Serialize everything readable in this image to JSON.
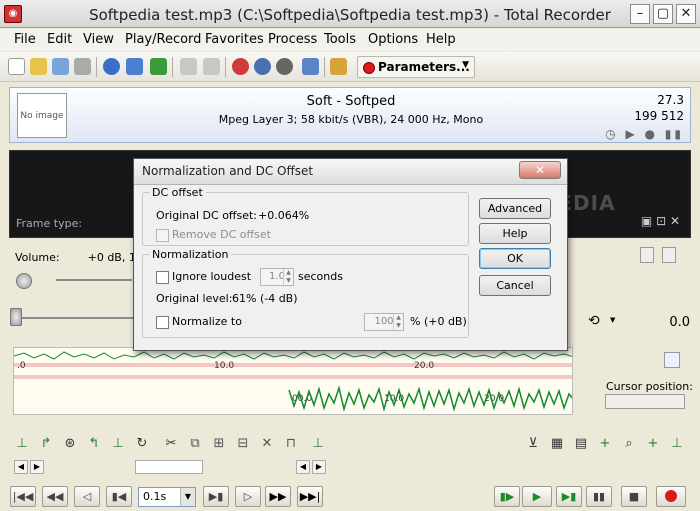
{
  "window": {
    "title": "Softpedia test.mp3 (C:\\Softpedia\\Softpedia test.mp3) - Total Recorder",
    "min": "–",
    "max": "▢",
    "close": "✕"
  },
  "menu": [
    "File",
    "Edit",
    "View",
    "Play/Record",
    "Favorites",
    "Process",
    "Tools",
    "Options",
    "Help"
  ],
  "toolbar": {
    "parameters_label": "Parameters..."
  },
  "info": {
    "no_image": "No image",
    "track_name": "Soft - Softped",
    "track_details": "Mpeg Layer 3; 58 kbit/s (VBR), 24 000 Hz, Mono",
    "time": "27.3",
    "size": "199 512",
    "icons": "◷ ▶ ● ▮▮"
  },
  "screen": {
    "frame_type_label": "Frame type:",
    "watermark": "SOFTPEDIA",
    "icon_text": "▣  ⊡ ✕"
  },
  "controls": {
    "volume_label": "Volume:",
    "volume_value": "+0 dB, 100",
    "position_value": "0.0"
  },
  "wave": {
    "ticks_top": [
      "10.0",
      "20.0"
    ],
    "ticks_bottom": [
      "00.0",
      "10.0",
      "20.0"
    ]
  },
  "cursor": {
    "label": "Cursor position:",
    "value": ""
  },
  "transport": {
    "step_value": "0.1s"
  },
  "dialog": {
    "title": "Normalization and DC Offset",
    "close": "✕",
    "dc_offset": {
      "legend": "DC offset",
      "original_label": "Original DC offset:",
      "original_value": "+0.064%",
      "remove_label": "Remove DC offset"
    },
    "normalization": {
      "legend": "Normalization",
      "ignore_label": "Ignore loudest",
      "ignore_value": "1.0",
      "seconds_label": "seconds",
      "level_label": "Original level:",
      "level_value": "61% (-4 dB)",
      "normalize_label": "Normalize to",
      "normalize_value": "100",
      "normalize_unit": "% (+0 dB)"
    },
    "buttons": {
      "advanced": "Advanced >>",
      "help": "Help",
      "ok": "OK",
      "cancel": "Cancel"
    }
  },
  "colors": {
    "record_red": "#d81b1b",
    "wave_green": "#138a2a",
    "accent_blue": "#3c7fb1"
  }
}
